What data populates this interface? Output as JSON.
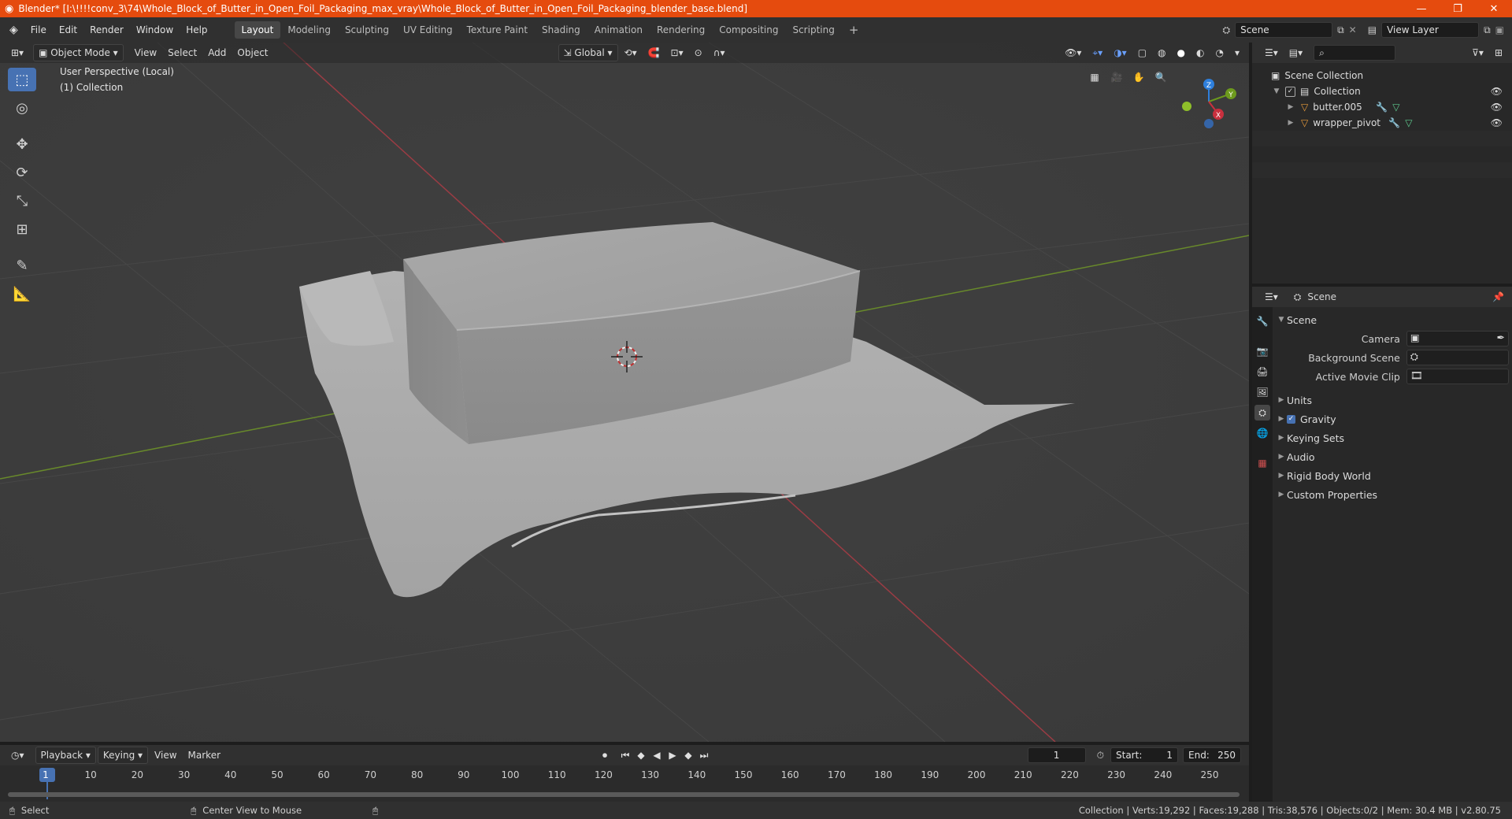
{
  "window": {
    "title": "Blender* [I:\\!!!!conv_3\\74\\Whole_Block_of_Butter_in_Open_Foil_Packaging_max_vray\\Whole_Block_of_Butter_in_Open_Foil_Packaging_blender_base.blend]",
    "minimize": "—",
    "maximize": "❐",
    "close": "✕"
  },
  "menus": [
    "File",
    "Edit",
    "Render",
    "Window",
    "Help"
  ],
  "workspaces": [
    "Layout",
    "Modeling",
    "Sculpting",
    "UV Editing",
    "Texture Paint",
    "Shading",
    "Animation",
    "Rendering",
    "Compositing",
    "Scripting"
  ],
  "active_workspace": "Layout",
  "add_workspace": "+",
  "scene_field": "Scene",
  "view_layer_field": "View Layer",
  "viewport": {
    "mode": "Object Mode",
    "menu": [
      "View",
      "Select",
      "Add",
      "Object"
    ],
    "orientation": "Global",
    "overlay_line1": "User Perspective (Local)",
    "overlay_line2": "(1) Collection",
    "gizmo": {
      "z": "Z",
      "y": "Y",
      "x": "X"
    }
  },
  "outliner": {
    "root": "Scene Collection",
    "collection": "Collection",
    "items": [
      "butter.005",
      "wrapper_pivot"
    ]
  },
  "properties": {
    "header": "Scene",
    "section": "Scene",
    "fields": [
      "Camera",
      "Background Scene",
      "Active Movie Clip"
    ],
    "subsections": [
      "Units",
      "Gravity",
      "Keying Sets",
      "Audio",
      "Rigid Body World",
      "Custom Properties"
    ],
    "gravity_checked": true
  },
  "timeline": {
    "menu": [
      "Playback",
      "Keying",
      "View",
      "Marker"
    ],
    "current_frame": "1",
    "start_label": "Start:",
    "start": "1",
    "end_label": "End:",
    "end": "250",
    "ticks": [
      "1",
      "10",
      "20",
      "30",
      "40",
      "50",
      "60",
      "70",
      "80",
      "90",
      "100",
      "110",
      "120",
      "130",
      "140",
      "150",
      "160",
      "170",
      "180",
      "190",
      "200",
      "210",
      "220",
      "230",
      "240",
      "250"
    ]
  },
  "status": {
    "left1": "Select",
    "left2": "Center View to Mouse",
    "right": "Collection | Verts:19,292 | Faces:19,288 | Tris:38,576 | Objects:0/2 | Mem: 30.4 MB | v2.80.75"
  },
  "colors": {
    "accent": "#4772b3",
    "titlebar": "#e54b0e",
    "xaxis": "#c9303e",
    "yaxis": "#6d9a1d",
    "zaxis": "#2e7fdc"
  }
}
